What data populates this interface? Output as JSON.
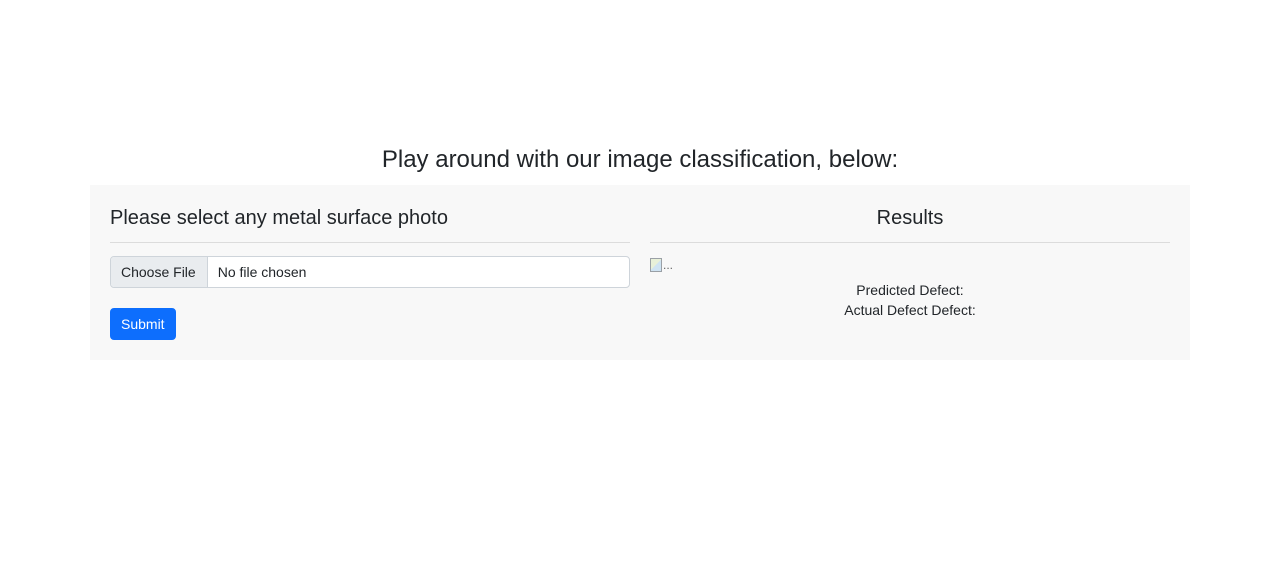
{
  "page": {
    "title": "Play around with our image classification, below:"
  },
  "upload": {
    "heading": "Please select any metal surface photo",
    "file_button_label": "Choose File",
    "file_status": "No file chosen",
    "submit_label": "Submit"
  },
  "results": {
    "heading": "Results",
    "image_alt": "...",
    "predicted_label": "Predicted Defect:",
    "actual_label": "Actual Defect Defect:"
  },
  "colors": {
    "primary": "#0d6efd",
    "panel_background": "#f8f8f8"
  },
  "icons": {
    "broken_image": "broken-image-icon"
  }
}
